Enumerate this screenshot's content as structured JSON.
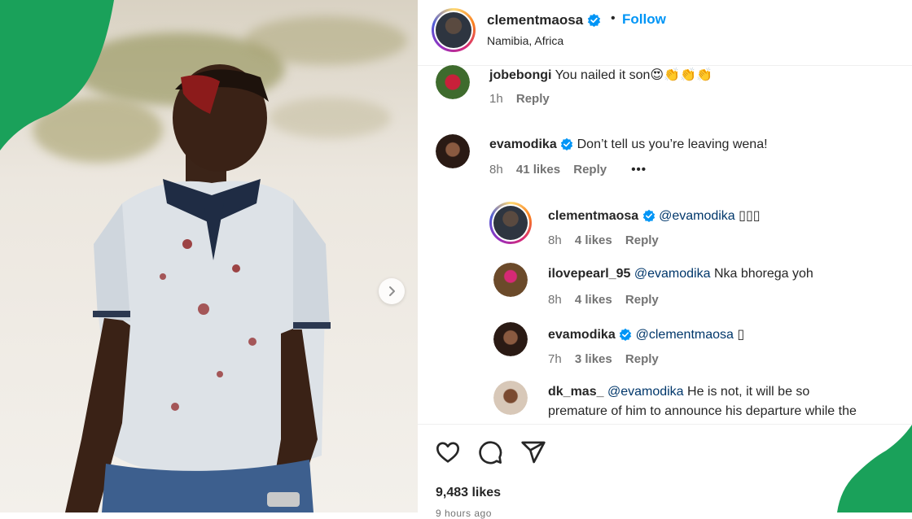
{
  "post": {
    "author": "clementmaosa",
    "follow_label": "Follow",
    "separator": "•",
    "location": "Namibia, Africa",
    "likes": "9,483 likes",
    "time_ago": "9 hours ago"
  },
  "comments": [
    {
      "username": "jobebongi",
      "text": "You nailed it son😍👏👏👏",
      "time": "1h",
      "likes": "",
      "reply": "Reply"
    },
    {
      "username": "evamodika",
      "text": "Don’t tell us you’re leaving wena!",
      "time": "8h",
      "likes": "41 likes",
      "reply": "Reply",
      "more": "•••"
    }
  ],
  "replies": [
    {
      "username": "clementmaosa",
      "mention": "@evamodika",
      "text": "▯▯▯",
      "time": "8h",
      "likes": "4 likes",
      "reply": "Reply"
    },
    {
      "username": "ilovepearl_95",
      "mention": "@evamodika",
      "text": "Nka bhorega yoh",
      "time": "8h",
      "likes": "4 likes",
      "reply": "Reply"
    },
    {
      "username": "evamodika",
      "mention": "@clementmaosa",
      "text": "▯",
      "time": "7h",
      "likes": "3 likes",
      "reply": "Reply"
    },
    {
      "username": "dk_mas_",
      "mention": "@evamodika",
      "text": "He is not, it will be so",
      "text2": "premature of him to announce his departure while the"
    }
  ],
  "icons": {
    "like": "heart-icon",
    "comment": "comment-icon",
    "share": "share-icon",
    "next": "chevron-right-icon",
    "verified": "verified-badge-icon"
  },
  "colors": {
    "follow": "#0095f6",
    "verified": "#0095f6",
    "meta_text": "#737373",
    "mention": "#00376b",
    "decor_green": "#1aa15a"
  }
}
